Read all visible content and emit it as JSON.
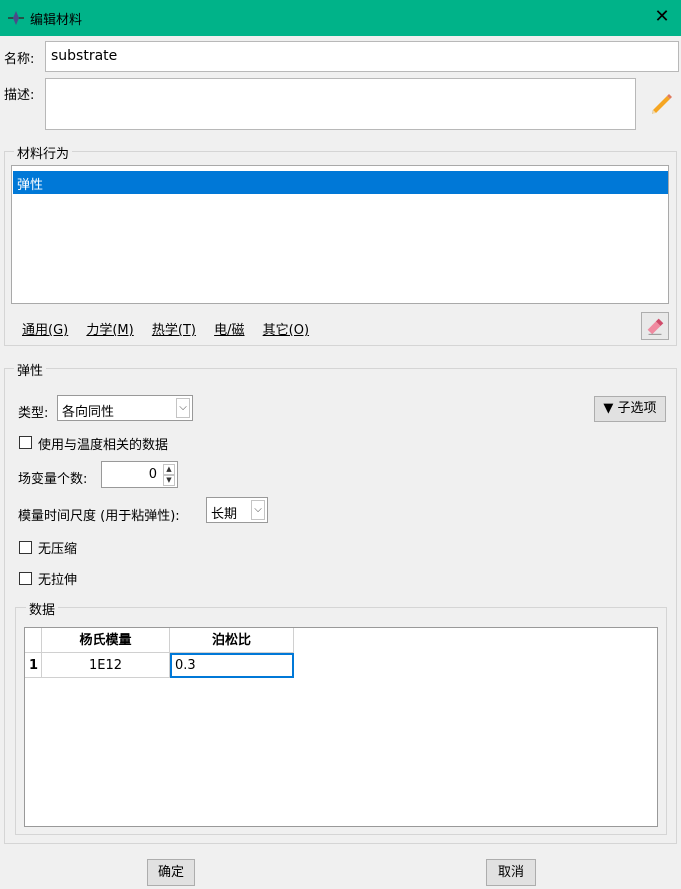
{
  "window": {
    "title": "编辑材料",
    "close_label": "✕"
  },
  "name": {
    "label": "名称:",
    "value": "substrate"
  },
  "description": {
    "label": "描述:",
    "value": ""
  },
  "behavior": {
    "group_title": "材料行为",
    "items": [
      "弹性"
    ],
    "menus": [
      "通用(G)",
      "力学(M)",
      "热学(T)",
      "电/磁",
      "其它(O)"
    ]
  },
  "elastic": {
    "group_title": "弹性",
    "type_label": "类型:",
    "type_value": "各向同性",
    "suboptions_label": "▼ 子选项",
    "temp_dependent_label": "使用与温度相关的数据",
    "temp_dependent_checked": false,
    "field_vars_label": "场变量个数:",
    "field_vars_value": "0",
    "time_scale_label": "模量时间尺度 (用于粘弹性):",
    "time_scale_value": "长期",
    "no_compression_label": "无压缩",
    "no_compression_checked": false,
    "no_tension_label": "无拉伸",
    "no_tension_checked": false
  },
  "data": {
    "group_title": "数据",
    "columns": [
      "杨氏模量",
      "泊松比"
    ],
    "rows": [
      {
        "index": "1",
        "cells": [
          "1E12",
          "0.3"
        ]
      }
    ]
  },
  "buttons": {
    "ok": "确定",
    "cancel": "取消"
  }
}
